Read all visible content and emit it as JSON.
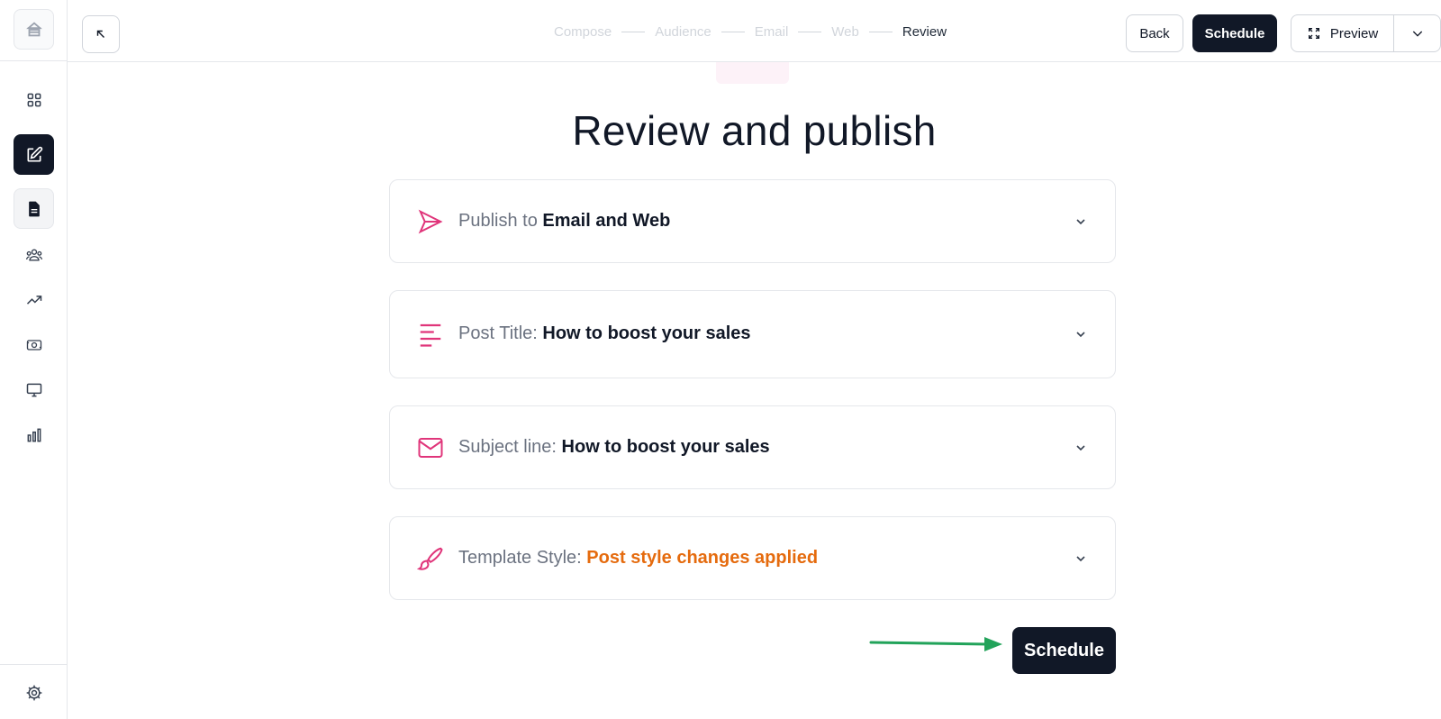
{
  "sidebar": {
    "logo_icon": "shop-logo-icon",
    "items": [
      {
        "icon": "dashboard-grid-icon"
      },
      {
        "icon": "edit-post-icon",
        "active": true
      },
      {
        "icon": "document-icon"
      },
      {
        "icon": "audience-icon"
      },
      {
        "icon": "trending-up-icon"
      },
      {
        "icon": "money-icon"
      },
      {
        "icon": "monitor-icon"
      },
      {
        "icon": "bar-chart-icon"
      }
    ],
    "settings_icon": "gear-icon"
  },
  "topbar": {
    "collapse_icon": "arrow-up-left-icon",
    "steps": [
      "Compose",
      "Audience",
      "Email",
      "Web",
      "Review"
    ],
    "current_step": "Review",
    "back_label": "Back",
    "schedule_label": "Schedule",
    "preview_label": "Preview",
    "preview_icon": "expand-icon",
    "preview_menu_icon": "chevron-down-icon"
  },
  "main": {
    "title": "Review and publish",
    "cards": [
      {
        "icon": "send-icon",
        "label": "Publish to",
        "value": "Email and Web"
      },
      {
        "icon": "text-lines-icon",
        "label": "Post Title:",
        "value": "How to boost your sales"
      },
      {
        "icon": "mail-icon",
        "label": "Subject line:",
        "value": "How to boost your sales"
      },
      {
        "icon": "paintbrush-icon",
        "label": "Template Style:",
        "value": "Post style changes applied"
      }
    ],
    "schedule_label": "Schedule"
  },
  "colors": {
    "accent_pink": "#e0357a",
    "dark": "#111827",
    "orange": "#e56b0e",
    "annotation_green": "#22a35a"
  }
}
